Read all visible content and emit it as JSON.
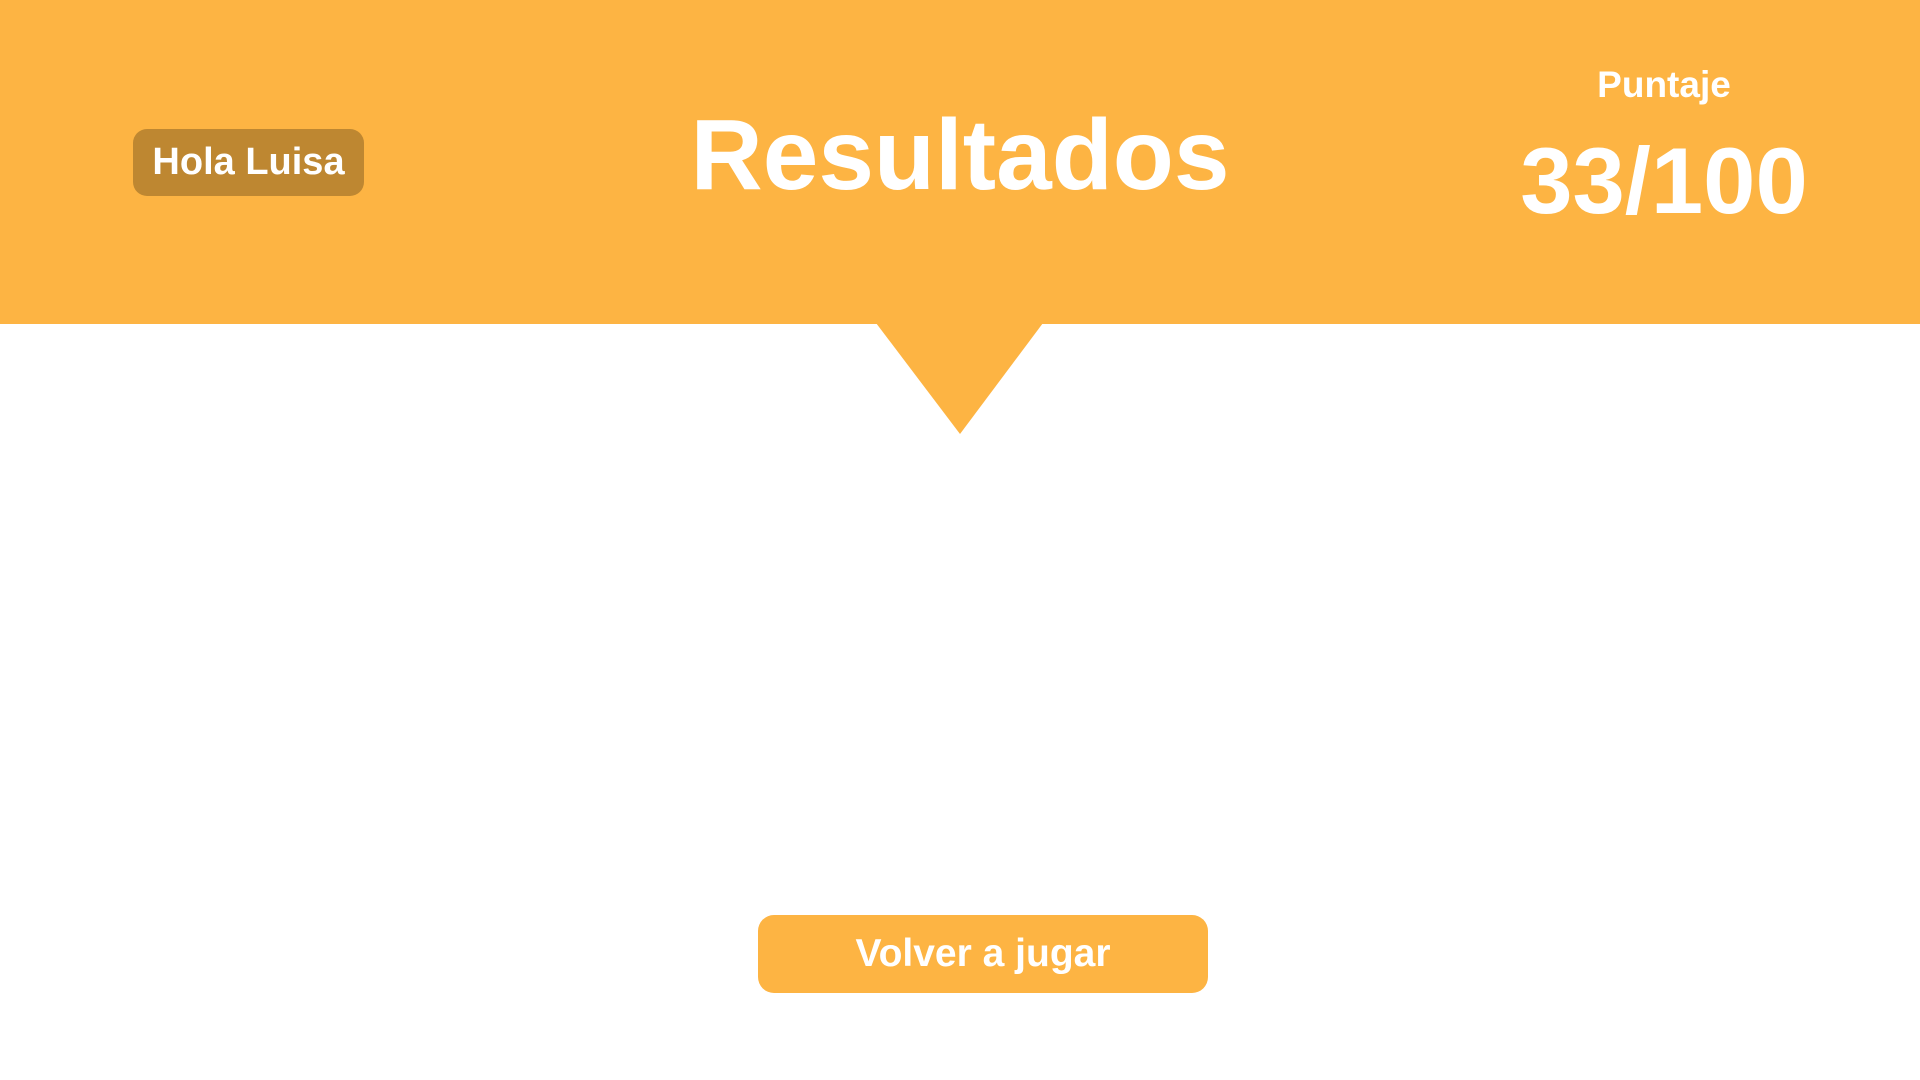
{
  "header": {
    "greeting": "Hola Luisa",
    "title": "Resultados",
    "score_label": "Puntaje",
    "score_value": "33/100"
  },
  "actions": {
    "replay_label": "Volver a jugar"
  },
  "colors": {
    "accent": "#FDB443",
    "greeting_bg": "#BE8731",
    "text": "#FFFFFF",
    "background": "#FFFFFF"
  }
}
